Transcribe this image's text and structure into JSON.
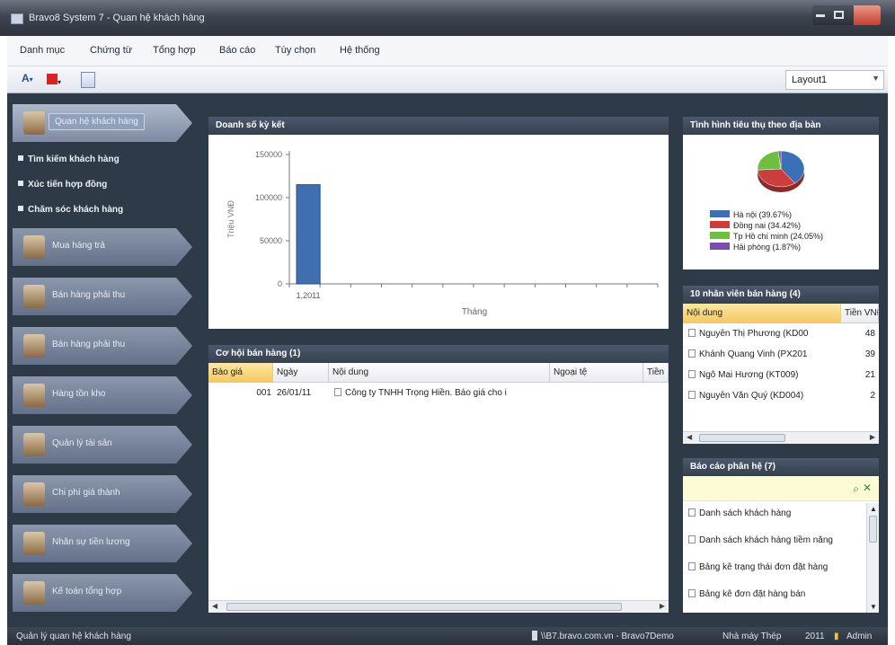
{
  "window": {
    "title": "Bravo8 System 7 - Quan hệ khách hàng"
  },
  "menu": [
    "Danh mục",
    "Chứng từ",
    "Tổng hợp",
    "Báo cáo",
    "Tùy chọn",
    "Hệ thống"
  ],
  "toolbar": {
    "layout_value": "Layout1"
  },
  "nav": {
    "items": [
      {
        "label": "Quan hệ khách hàng",
        "active": true
      },
      {
        "label": "Mua hàng trả",
        "active": false
      },
      {
        "label": "Bán hàng phải thu",
        "active": false
      },
      {
        "label": "Bán hàng phải thu",
        "active": false
      },
      {
        "label": "Hàng tồn kho",
        "active": false
      },
      {
        "label": "Quản lý tài sản",
        "active": false
      },
      {
        "label": "Chi phí giá thành",
        "active": false
      },
      {
        "label": "Nhân sự tiền lương",
        "active": false
      },
      {
        "label": "Kế toán tổng hợp",
        "active": false
      }
    ],
    "subitems": [
      "Tìm kiếm khách hàng",
      "Xúc tiến hợp đồng",
      "Chăm sóc khách hàng"
    ]
  },
  "sales_panel": {
    "title": "Doanh số kỳ kết"
  },
  "chart_data": {
    "type": "bar",
    "categories": [
      "1,2011"
    ],
    "values": [
      115000
    ],
    "ylabel": "Triệu VNĐ",
    "xlabel": "Tháng",
    "ylim": [
      0,
      150000
    ],
    "yticks": [
      "0",
      "50000",
      "100000",
      "150000"
    ],
    "color": "#3f6fae"
  },
  "opportunity": {
    "title": "Cơ hội bán hàng (1)",
    "columns": [
      "Báo giá",
      "Ngày",
      "Nội dung",
      "Ngoại tệ",
      "Tiền"
    ],
    "rows": [
      {
        "code": "001",
        "date": "26/01/11",
        "content": "Công ty TNHH Trọng Hiền. Báo giá cho i"
      }
    ]
  },
  "region_panel": {
    "title": "Tình hình tiêu thụ theo địa bàn",
    "pie": [
      {
        "label": "Hà nội (39.67%)",
        "value": 39.67,
        "color": "#3b6fb6"
      },
      {
        "label": "Đồng nai (34.42%)",
        "value": 34.42,
        "color": "#cc3d3d"
      },
      {
        "label": "Tp Hồ chí minh (24.05%)",
        "value": 24.05,
        "color": "#6fbf3f"
      },
      {
        "label": "Hải phòng (1.87%)",
        "value": 1.87,
        "color": "#7a4fa6"
      }
    ]
  },
  "top_sales": {
    "title": "10 nhân viên bán hàng (4)",
    "columns": [
      "Nội dung",
      "Tiền VNĐ"
    ],
    "rows": [
      {
        "name": "Nguyễn Thị Phương (KD00",
        "amount": "48"
      },
      {
        "name": "Khánh Quang Vinh (PX201",
        "amount": "39"
      },
      {
        "name": "Ngô Mai Hương (KT009)",
        "amount": "21"
      },
      {
        "name": "Nguyễn Văn Quý (KD004)",
        "amount": "2"
      }
    ]
  },
  "reports": {
    "title": "Báo cáo phân hệ (7)",
    "items": [
      "Danh sách khách hàng",
      "Danh sách khách hàng tiềm năng",
      "Bảng kê trạng thái đơn đặt hàng",
      "Bảng kê đơn đặt hàng bán"
    ]
  },
  "status": {
    "left": "Quản lý quan hệ khách hàng",
    "server": "\\\\B7.bravo.com.vn - Bravo7Demo",
    "branch": "Nhà máy Thép",
    "year": "2011",
    "user": "Admin"
  }
}
